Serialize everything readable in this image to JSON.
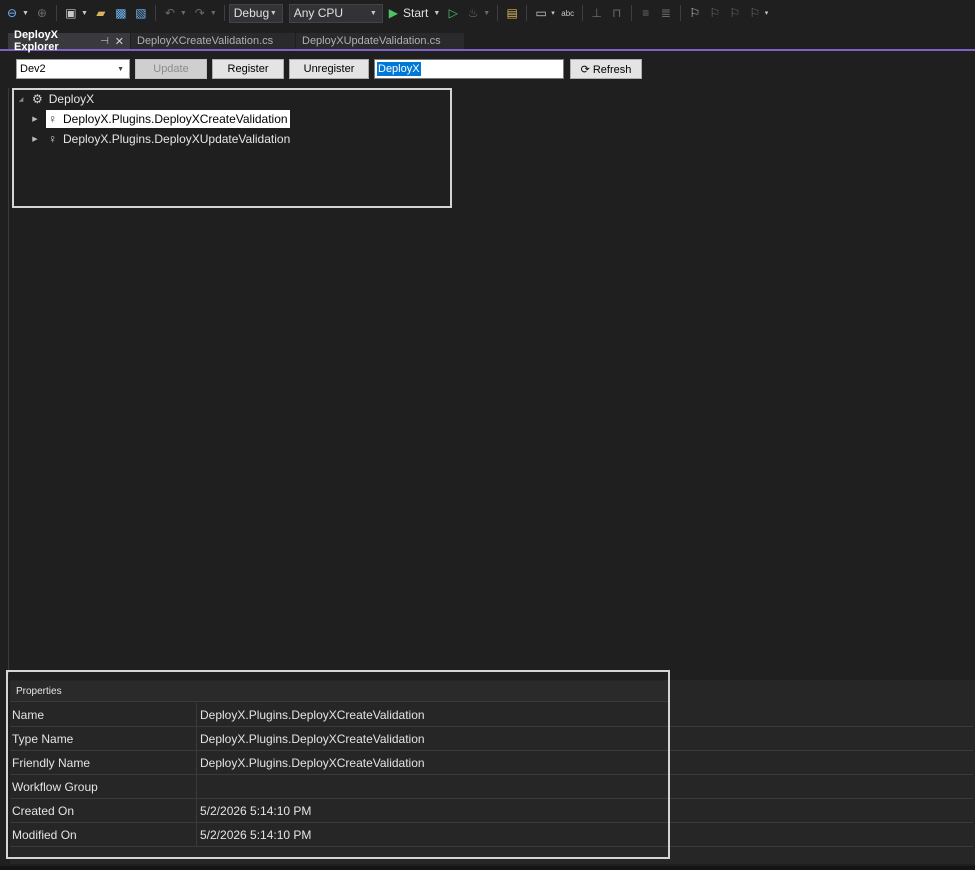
{
  "toolbar": {
    "configuration": "Debug",
    "platform": "Any CPU",
    "start_label": "Start",
    "icons": [
      "back-icon",
      "forward-icon",
      "new-project-icon",
      "open-folder-icon",
      "save-icon",
      "save-all-icon",
      "undo-icon",
      "redo-icon",
      "start-icon",
      "start-without-debugging-icon",
      "hot-reload-icon",
      "solution-explorer-icon",
      "window-layout-icon",
      "spell-check-icon",
      "comment-icon",
      "uncomment-icon",
      "indent-icon",
      "outdent-icon",
      "bookmark-icon",
      "bookmark-prev-icon",
      "bookmark-next-icon",
      "bookmark-clear-icon"
    ]
  },
  "tabs": [
    {
      "label": "DeployX Explorer",
      "active": true
    },
    {
      "label": "DeployXCreateValidation.cs",
      "active": false
    },
    {
      "label": "DeployXUpdateValidation.cs",
      "active": false
    }
  ],
  "controls": {
    "environment": "Dev2",
    "update_label": "Update",
    "register_label": "Register",
    "unregister_label": "Unregister",
    "filter_value": "DeployX",
    "refresh_label": "⟳ Refresh"
  },
  "tree": {
    "root": "DeployX",
    "children": [
      {
        "label": "DeployX.Plugins.DeployXCreateValidation",
        "selected": true
      },
      {
        "label": "DeployX.Plugins.DeployXUpdateValidation",
        "selected": false
      }
    ]
  },
  "properties": {
    "header": "Properties",
    "rows": [
      {
        "key": "Name",
        "value": "DeployX.Plugins.DeployXCreateValidation"
      },
      {
        "key": "Type Name",
        "value": "DeployX.Plugins.DeployXCreateValidation"
      },
      {
        "key": "Friendly Name",
        "value": "DeployX.Plugins.DeployXCreateValidation"
      },
      {
        "key": "Workflow Group",
        "value": ""
      },
      {
        "key": "Created On",
        "value": "5/2/2026 5:14:10 PM"
      },
      {
        "key": "Modified On",
        "value": "5/2/2026 5:14:10 PM"
      }
    ]
  },
  "colors": {
    "background": "#1f1f1f",
    "tab_accent": "#7f62c6",
    "selection": "#0078d7",
    "run_green": "#4cc269"
  }
}
